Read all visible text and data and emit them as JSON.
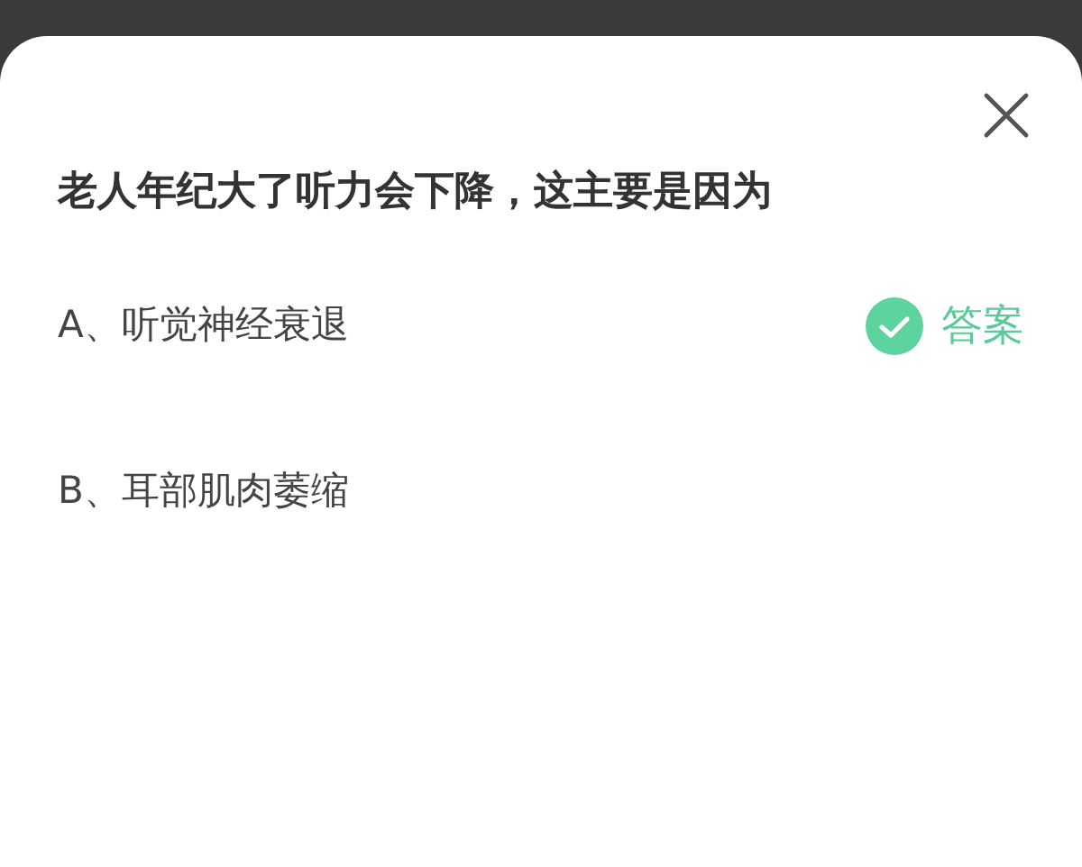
{
  "question": "老人年纪大了听力会下降，这主要是因为",
  "options": [
    {
      "label": "A、听觉神经衰退",
      "correct": true,
      "badge": "答案"
    },
    {
      "label": "B、耳部肌肉萎缩",
      "correct": false
    }
  ]
}
